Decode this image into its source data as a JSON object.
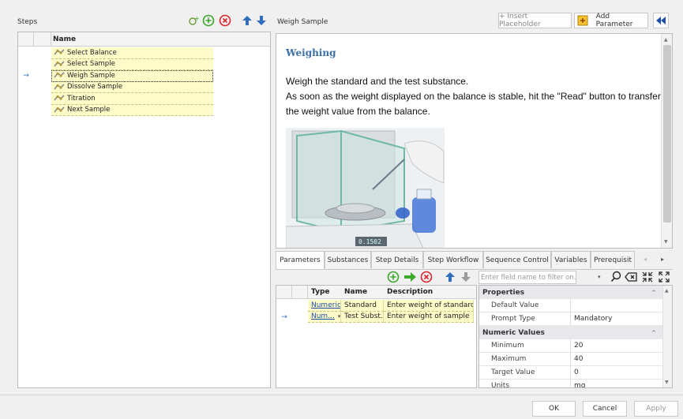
{
  "steps_panel": {
    "title": "Steps",
    "column_name": "Name",
    "items": [
      {
        "label": "Select Balance",
        "current": false
      },
      {
        "label": "Select Sample",
        "current": false
      },
      {
        "label": "Weigh Sample",
        "current": true
      },
      {
        "label": "Dissolve Sample",
        "current": false
      },
      {
        "label": "Titration",
        "current": false
      },
      {
        "label": "Next Sample",
        "current": false
      }
    ]
  },
  "editor": {
    "title": "Weigh Sample",
    "insert_placeholder": "+ Insert Placeholder",
    "add_parameter": "Add Parameter",
    "heading": "Weighing",
    "paragraph_1": "Weigh the standard and the test substance.",
    "paragraph_2": "As soon as the weight displayed on the balance is stable, hit the \"Read\" button to transfer the weight value from the balance.",
    "balance_display": "0.1502"
  },
  "tabs": [
    "Parameters",
    "Substances",
    "Step Details",
    "Step Workflow",
    "Sequence Control",
    "Variables",
    "Prerequisit"
  ],
  "params_table": {
    "headers": [
      "Type",
      "Name",
      "Description"
    ],
    "rows": [
      {
        "type": "Numeric",
        "name": "Standard",
        "description": "Enter weight of standard",
        "current": false
      },
      {
        "type": "Num...",
        "name": "Test Subst...",
        "description": "Enter weight of sample",
        "current": true
      }
    ]
  },
  "filter": {
    "placeholder": "Enter field name to filter on..."
  },
  "properties": {
    "cat_properties": "Properties",
    "default_value_label": "Default Value",
    "default_value": "",
    "prompt_type_label": "Prompt Type",
    "prompt_type": "Mandatory",
    "cat_numeric": "Numeric Values",
    "minimum_label": "Minimum",
    "minimum": "20",
    "maximum_label": "Maximum",
    "maximum": "40",
    "target_label": "Target Value",
    "target": "0",
    "units_label": "Units",
    "units": "mg"
  },
  "footer": {
    "ok": "OK",
    "cancel": "Cancel",
    "apply": "Apply"
  },
  "colors": {
    "accent": "#2f6ebf",
    "green": "#3aa829",
    "red": "#d9262c",
    "highlight": "#fdfbc8"
  }
}
